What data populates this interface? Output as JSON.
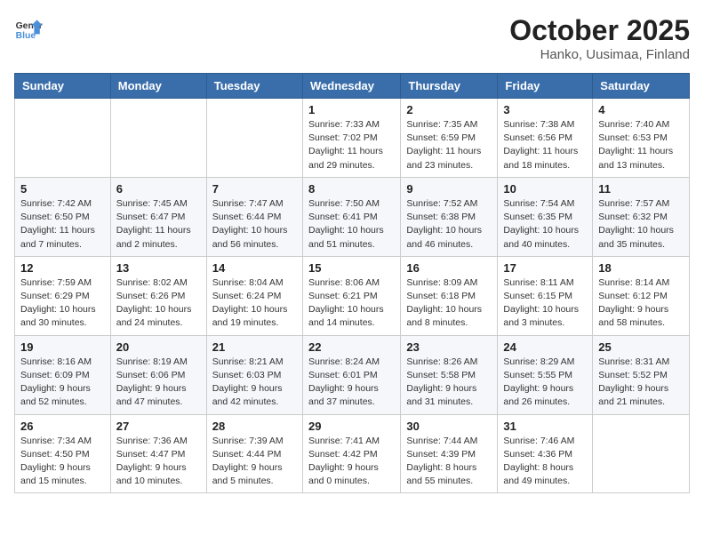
{
  "header": {
    "logo_general": "General",
    "logo_blue": "Blue",
    "title": "October 2025",
    "subtitle": "Hanko, Uusimaa, Finland"
  },
  "weekdays": [
    "Sunday",
    "Monday",
    "Tuesday",
    "Wednesday",
    "Thursday",
    "Friday",
    "Saturday"
  ],
  "weeks": [
    [
      {
        "day": "",
        "info": ""
      },
      {
        "day": "",
        "info": ""
      },
      {
        "day": "",
        "info": ""
      },
      {
        "day": "1",
        "info": "Sunrise: 7:33 AM\nSunset: 7:02 PM\nDaylight: 11 hours\nand 29 minutes."
      },
      {
        "day": "2",
        "info": "Sunrise: 7:35 AM\nSunset: 6:59 PM\nDaylight: 11 hours\nand 23 minutes."
      },
      {
        "day": "3",
        "info": "Sunrise: 7:38 AM\nSunset: 6:56 PM\nDaylight: 11 hours\nand 18 minutes."
      },
      {
        "day": "4",
        "info": "Sunrise: 7:40 AM\nSunset: 6:53 PM\nDaylight: 11 hours\nand 13 minutes."
      }
    ],
    [
      {
        "day": "5",
        "info": "Sunrise: 7:42 AM\nSunset: 6:50 PM\nDaylight: 11 hours\nand 7 minutes."
      },
      {
        "day": "6",
        "info": "Sunrise: 7:45 AM\nSunset: 6:47 PM\nDaylight: 11 hours\nand 2 minutes."
      },
      {
        "day": "7",
        "info": "Sunrise: 7:47 AM\nSunset: 6:44 PM\nDaylight: 10 hours\nand 56 minutes."
      },
      {
        "day": "8",
        "info": "Sunrise: 7:50 AM\nSunset: 6:41 PM\nDaylight: 10 hours\nand 51 minutes."
      },
      {
        "day": "9",
        "info": "Sunrise: 7:52 AM\nSunset: 6:38 PM\nDaylight: 10 hours\nand 46 minutes."
      },
      {
        "day": "10",
        "info": "Sunrise: 7:54 AM\nSunset: 6:35 PM\nDaylight: 10 hours\nand 40 minutes."
      },
      {
        "day": "11",
        "info": "Sunrise: 7:57 AM\nSunset: 6:32 PM\nDaylight: 10 hours\nand 35 minutes."
      }
    ],
    [
      {
        "day": "12",
        "info": "Sunrise: 7:59 AM\nSunset: 6:29 PM\nDaylight: 10 hours\nand 30 minutes."
      },
      {
        "day": "13",
        "info": "Sunrise: 8:02 AM\nSunset: 6:26 PM\nDaylight: 10 hours\nand 24 minutes."
      },
      {
        "day": "14",
        "info": "Sunrise: 8:04 AM\nSunset: 6:24 PM\nDaylight: 10 hours\nand 19 minutes."
      },
      {
        "day": "15",
        "info": "Sunrise: 8:06 AM\nSunset: 6:21 PM\nDaylight: 10 hours\nand 14 minutes."
      },
      {
        "day": "16",
        "info": "Sunrise: 8:09 AM\nSunset: 6:18 PM\nDaylight: 10 hours\nand 8 minutes."
      },
      {
        "day": "17",
        "info": "Sunrise: 8:11 AM\nSunset: 6:15 PM\nDaylight: 10 hours\nand 3 minutes."
      },
      {
        "day": "18",
        "info": "Sunrise: 8:14 AM\nSunset: 6:12 PM\nDaylight: 9 hours\nand 58 minutes."
      }
    ],
    [
      {
        "day": "19",
        "info": "Sunrise: 8:16 AM\nSunset: 6:09 PM\nDaylight: 9 hours\nand 52 minutes."
      },
      {
        "day": "20",
        "info": "Sunrise: 8:19 AM\nSunset: 6:06 PM\nDaylight: 9 hours\nand 47 minutes."
      },
      {
        "day": "21",
        "info": "Sunrise: 8:21 AM\nSunset: 6:03 PM\nDaylight: 9 hours\nand 42 minutes."
      },
      {
        "day": "22",
        "info": "Sunrise: 8:24 AM\nSunset: 6:01 PM\nDaylight: 9 hours\nand 37 minutes."
      },
      {
        "day": "23",
        "info": "Sunrise: 8:26 AM\nSunset: 5:58 PM\nDaylight: 9 hours\nand 31 minutes."
      },
      {
        "day": "24",
        "info": "Sunrise: 8:29 AM\nSunset: 5:55 PM\nDaylight: 9 hours\nand 26 minutes."
      },
      {
        "day": "25",
        "info": "Sunrise: 8:31 AM\nSunset: 5:52 PM\nDaylight: 9 hours\nand 21 minutes."
      }
    ],
    [
      {
        "day": "26",
        "info": "Sunrise: 7:34 AM\nSunset: 4:50 PM\nDaylight: 9 hours\nand 15 minutes."
      },
      {
        "day": "27",
        "info": "Sunrise: 7:36 AM\nSunset: 4:47 PM\nDaylight: 9 hours\nand 10 minutes."
      },
      {
        "day": "28",
        "info": "Sunrise: 7:39 AM\nSunset: 4:44 PM\nDaylight: 9 hours\nand 5 minutes."
      },
      {
        "day": "29",
        "info": "Sunrise: 7:41 AM\nSunset: 4:42 PM\nDaylight: 9 hours\nand 0 minutes."
      },
      {
        "day": "30",
        "info": "Sunrise: 7:44 AM\nSunset: 4:39 PM\nDaylight: 8 hours\nand 55 minutes."
      },
      {
        "day": "31",
        "info": "Sunrise: 7:46 AM\nSunset: 4:36 PM\nDaylight: 8 hours\nand 49 minutes."
      },
      {
        "day": "",
        "info": ""
      }
    ]
  ]
}
